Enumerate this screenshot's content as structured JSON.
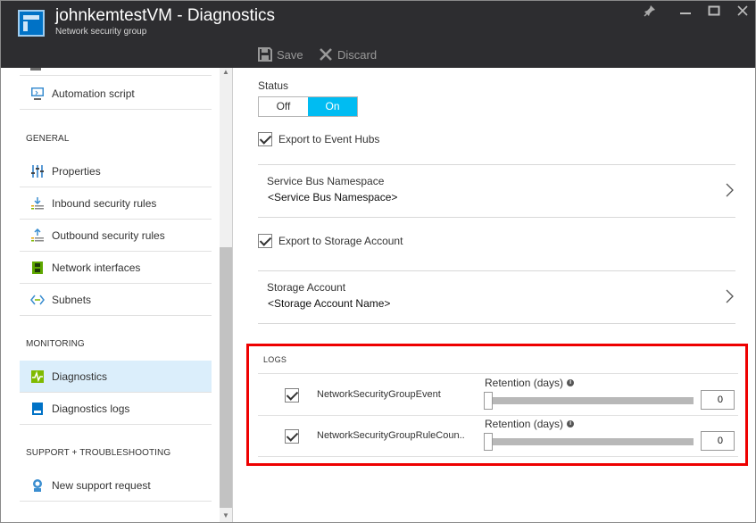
{
  "window": {
    "title": "johnkemtestVM - Diagnostics",
    "subtitle": "Network security group",
    "controls": [
      "pin-icon",
      "minimize-icon",
      "maximize-icon",
      "close-icon"
    ]
  },
  "toolbar": {
    "save_label": "Save",
    "discard_label": "Discard"
  },
  "sidebar": {
    "top_items": [
      {
        "label": "Automation script",
        "icon": "monitor-icon"
      }
    ],
    "sections": [
      {
        "title": "GENERAL",
        "items": [
          {
            "label": "Properties",
            "icon": "sliders-icon"
          },
          {
            "label": "Inbound security rules",
            "icon": "inbound-rules-icon"
          },
          {
            "label": "Outbound security rules",
            "icon": "outbound-rules-icon"
          },
          {
            "label": "Network interfaces",
            "icon": "network-interface-icon"
          },
          {
            "label": "Subnets",
            "icon": "subnet-icon"
          }
        ]
      },
      {
        "title": "MONITORING",
        "items": [
          {
            "label": "Diagnostics",
            "icon": "diagnostics-icon",
            "active": true
          },
          {
            "label": "Diagnostics logs",
            "icon": "diagnostics-logs-icon"
          }
        ]
      },
      {
        "title": "SUPPORT + TROUBLESHOOTING",
        "items": [
          {
            "label": "New support request",
            "icon": "support-request-icon"
          }
        ]
      }
    ]
  },
  "main": {
    "status_label": "Status",
    "status_toggle": {
      "off": "Off",
      "on": "On",
      "selected": "On"
    },
    "export_event_hubs": {
      "label": "Export to Event Hubs",
      "checked": true
    },
    "service_bus": {
      "label": "Service Bus Namespace",
      "value": "<Service Bus Namespace>"
    },
    "export_storage": {
      "label": "Export to Storage Account",
      "checked": true
    },
    "storage_account": {
      "label": "Storage Account",
      "value": "<Storage Account Name>"
    },
    "logs": {
      "title": "LOGS",
      "rows": [
        {
          "name": "NetworkSecurityGroupEvent",
          "checked": true,
          "retention_label": "Retention (days)",
          "retention_value": "0"
        },
        {
          "name": "NetworkSecurityGroupRuleCoun..",
          "checked": true,
          "retention_label": "Retention (days)",
          "retention_value": "0"
        }
      ]
    }
  },
  "colors": {
    "header_bg": "#2d2d30",
    "accent": "#00bcf2",
    "active_nav_bg": "#dbeefb",
    "highlight_border": "#e00000"
  }
}
